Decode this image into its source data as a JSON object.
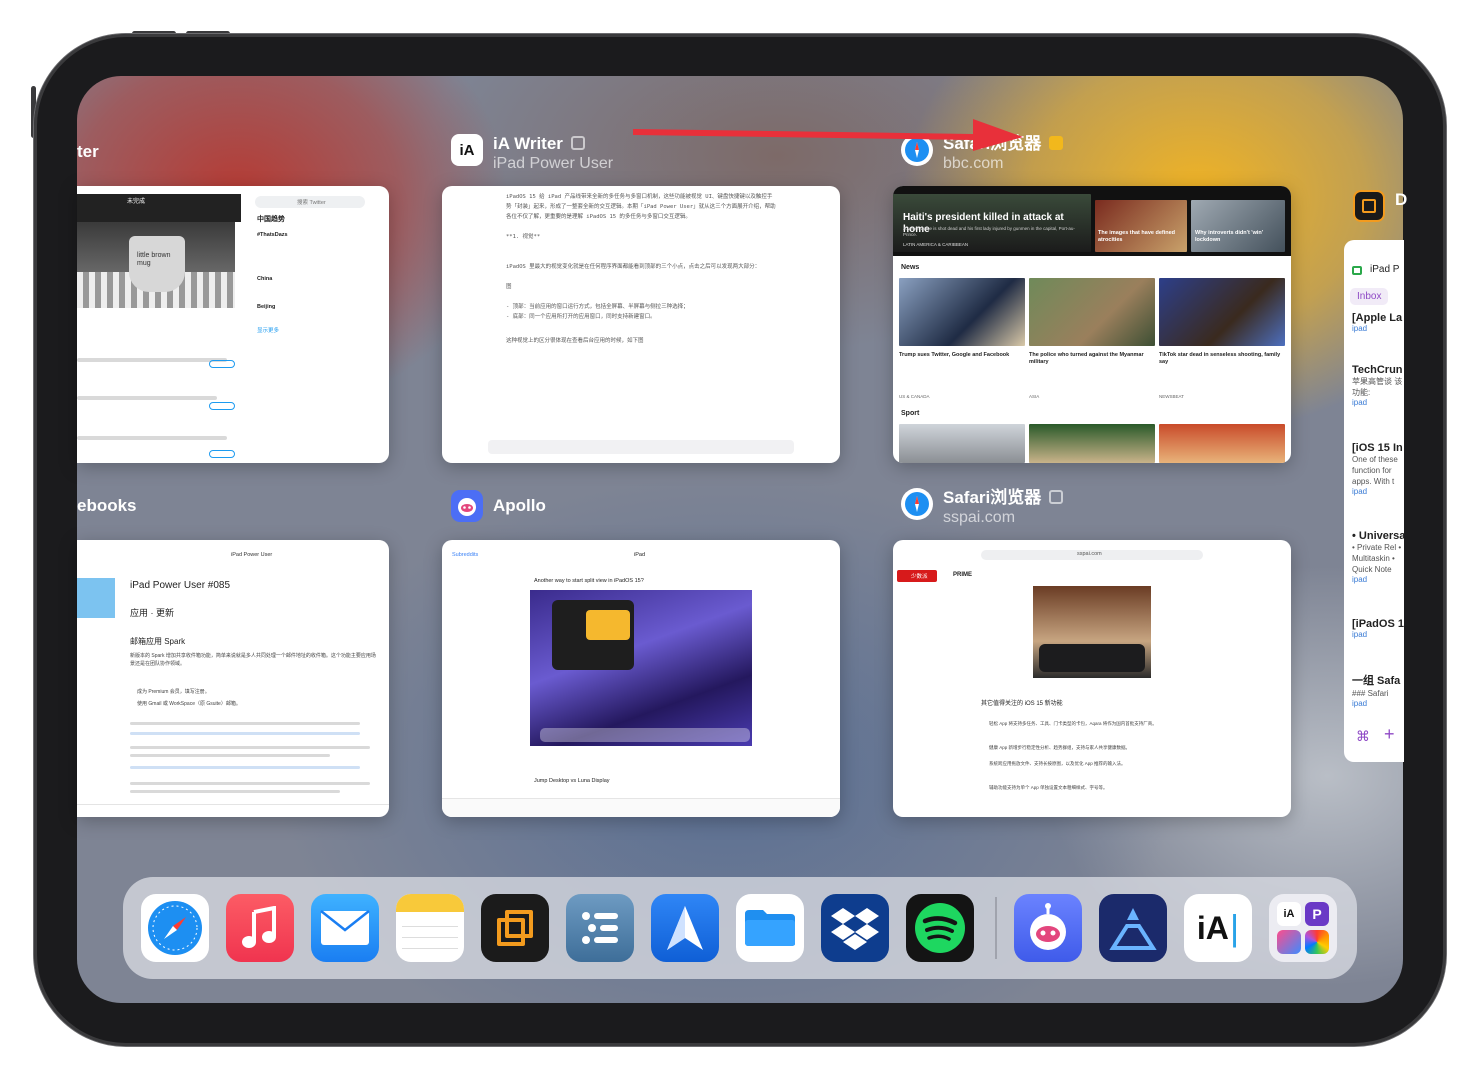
{
  "device": "iPad",
  "switcher": {
    "tiles": [
      {
        "title": "ter",
        "subtitle": ""
      },
      {
        "title": "iA Writer",
        "subtitle": "iPad Power User"
      },
      {
        "title": "Safari浏览器",
        "subtitle": "bbc.com"
      },
      {
        "title": "ebooks",
        "subtitle": ""
      },
      {
        "title": "Apollo",
        "subtitle": ""
      },
      {
        "title": "Safari浏览器",
        "subtitle": "sspai.com"
      },
      {
        "title": "D",
        "subtitle": ""
      }
    ]
  },
  "twitter_card": {
    "trending_header": "中国趋势",
    "search_placeholder": "搜索 Twitter",
    "trend1_tag": "#ThatsDazs",
    "trend2": "China",
    "trend3": "Beijing",
    "show_more": "显示更多",
    "mug_text": "little brown mug",
    "mug_header": "未完成"
  },
  "iawriter_card": {
    "para1": "iPadOS 15 给 iPad 产品线带来全新的多任务与多窗口机制，这些功能被视觉 UI、键盘快捷键以及触控手势「封装」起来，形成了一整套全新的交互逻辑。本期「iPad Power User」就从这三个方面展开介绍，帮助各位不仅了解，更重要的是理解 iPadOS 15 的多任务与多窗口交互逻辑。",
    "heading": "**1. 视觉**",
    "para2": "iPadOS 里最大的视觉变化就是在任何程序界面都能看到顶部的三个小点，点击之后可以发现两大部分：",
    "fig": "图",
    "bullet1": "- 顶部：当前应用的窗口运行方式，包括全屏幕、半屏幕与侧拉三种选择；",
    "bullet2": "- 底部：同一个应用所打开的应用窗口，同时支持新建窗口。",
    "para3": "这种视觉上的区分很体现在查看后台应用的时候，如下图"
  },
  "bbc_card": {
    "hero": "Haiti's president killed in attack at home",
    "hero_sub": "Jovenel Moïse is shot dead and his first lady injured by gunmen in the capital, Port-au-Prince.",
    "hero_tag": "LATIN AMERICA & CARIBBEAN",
    "hero2": "The images that have defined atrocities",
    "hero3": "Why introverts didn't 'win' lockdown",
    "news": "News",
    "story1": "Trump sues Twitter, Google and Facebook",
    "story2": "The police who turned against the Myanmar military",
    "story3": "TikTok star dead in senseless shooting, family say",
    "tag1": "US & CANADA",
    "tag2": "ASIA",
    "tag3": "NEWSBEAT",
    "sport": "Sport"
  },
  "ebooks_card": {
    "window_title": "iPad Power User",
    "doc_title": "iPad Power User #085",
    "subtitle": "应用 · 更新",
    "section": "邮箱应用 Spark",
    "body": "新版本的 Spark 增加共享收件箱功能，简单来说就是多人共同处理一个邮件地址的收件箱。这个功能主要应用场景还是在团队协作领域。",
    "bullet1": "成为 Premium 会员，填写注册。",
    "bullet2": "使用 Gmail 或 WorkSpace（原 Gsuite）邮箱。"
  },
  "apollo_card": {
    "back": "Subreddits",
    "title": "iPad",
    "post1": "Another way to start split view in iPadOS 15?",
    "post2": "Jump Desktop vs Luna Display"
  },
  "sspai_card": {
    "url": "sspai.com",
    "brand": "少数派",
    "prime": "PRIME",
    "heading": "其它值得关注的 iOS 15 新功能",
    "b1": "轻松 App 将支持多任务、工具、门卡类型的卡包，Aqara 将作为国内首批支持厂商。",
    "b2": "健康 App 新增步行稳定性分析、趋势群组，支持与家人共享健康数据。",
    "b3": "系统跨应用拖放文件、支持长按原图，以及优化 App 推荐的输入法。",
    "b4": "辅助功能支持为单个 App 单独设置文本粗细样式、字号等。"
  },
  "drafts_panel": {
    "title": "iPad P",
    "tab": "Inbox",
    "items": [
      {
        "title": "[Apple La",
        "snippet": "",
        "tag": "ipad"
      },
      {
        "title": "TechCrun",
        "snippet": "苹果高管谈 该功能:",
        "tag": "ipad"
      },
      {
        "title": "[iOS 15 In",
        "snippet": "One of these function for apps. With t",
        "tag": "ipad"
      },
      {
        "title": "• Universa",
        "snippet": "• Private Rel • Multitaskin • Quick Note",
        "tag": "ipad"
      },
      {
        "title": "[iPadOS 1",
        "snippet": "",
        "tag": "ipad"
      },
      {
        "title": "一组 Safa",
        "snippet": "### Safari",
        "tag": "ipad"
      }
    ]
  },
  "dock": {
    "apps": [
      "Safari",
      "Music",
      "Mail",
      "Notes",
      "Readdle",
      "OmniOutliner",
      "Spark",
      "Files",
      "Dropbox",
      "Spotify",
      "Apollo",
      "Affinity Designer",
      "iA Writer",
      "App Library"
    ]
  },
  "colors": {
    "arrow": "#e8303a",
    "safari_blue": "#1d8ff2",
    "music_red": "#fa3e55",
    "spotify_green": "#1ed760",
    "dropbox_blue": "#0061fe"
  }
}
